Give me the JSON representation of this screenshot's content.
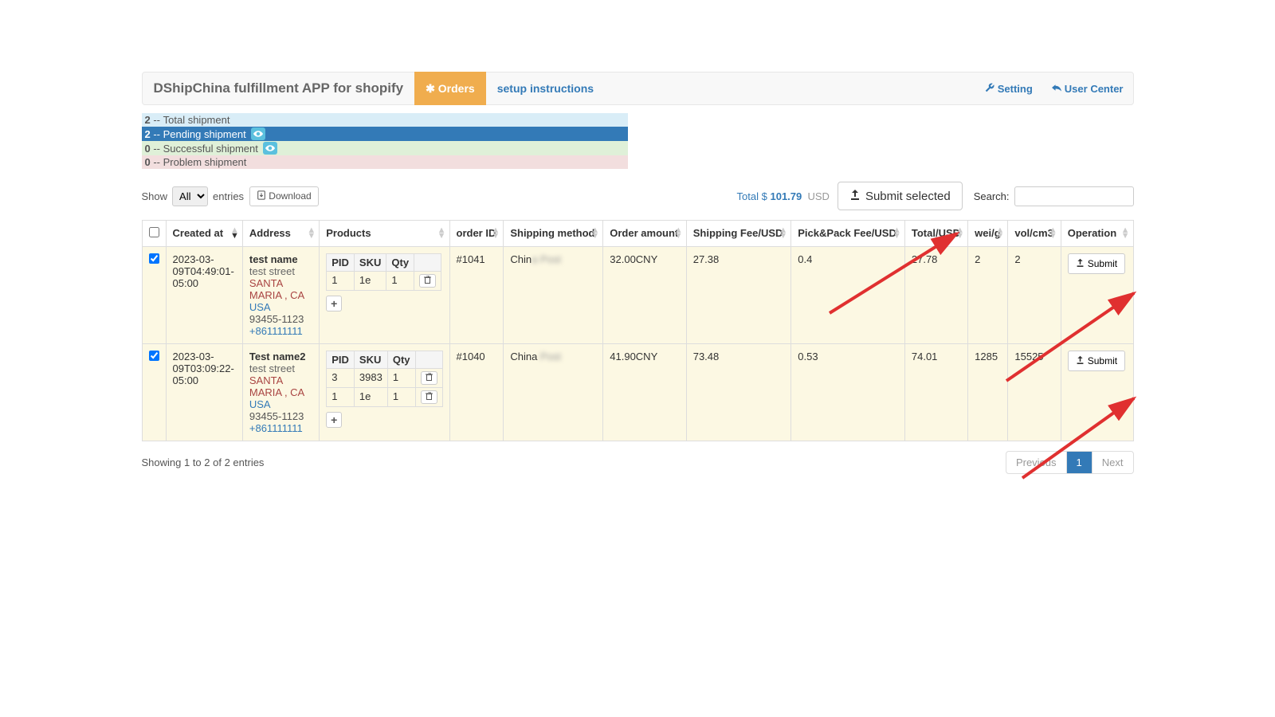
{
  "header": {
    "brand": "DShipChina fulfillment APP for shopify",
    "tab_orders": "Orders",
    "tab_setup": "setup instructions",
    "setting": "Setting",
    "user_center": "User Center"
  },
  "status": {
    "total": {
      "count": "2",
      "label": "Total shipment"
    },
    "pending": {
      "count": "2",
      "label": "Pending shipment"
    },
    "success": {
      "count": "0",
      "label": "Successful shipment"
    },
    "problem": {
      "count": "0",
      "label": "Problem shipment"
    }
  },
  "toolbar": {
    "show": "Show",
    "all": "All",
    "entries": "entries",
    "download": "Download",
    "total_prefix": "Total $",
    "total_amount": "101.79",
    "total_suffix": "USD",
    "submit_selected": "Submit selected",
    "search": "Search:"
  },
  "columns": {
    "created_at": "Created at",
    "address": "Address",
    "products": "Products",
    "order_id": "order ID",
    "shipping_method": "Shipping method",
    "order_amount": "Order amount",
    "shipping_fee": "Shipping Fee/USD",
    "pickpack_fee": "Pick&Pack Fee/USD",
    "total": "Total/USD",
    "wei": "wei/g",
    "vol": "vol/cm3",
    "operation": "Operation"
  },
  "ptable_headers": {
    "pid": "PID",
    "sku": "SKU",
    "qty": "Qty"
  },
  "rows": [
    {
      "checked": true,
      "created_at": "2023-03-09T04:49:01-05:00",
      "address": {
        "name": "test name",
        "street": "test street",
        "city": "SANTA MARIA , CA",
        "country": "USA",
        "zip": "93455-1123",
        "phone": "+861111111"
      },
      "products": [
        {
          "pid": "1",
          "sku": "1e",
          "qty": "1"
        }
      ],
      "order_id": "#1041",
      "shipping_method_visible": "Chin",
      "shipping_method_hidden": "a Post",
      "order_amount": "32.00CNY",
      "shipping_fee": "27.38",
      "pickpack_fee": "0.4",
      "total": "27.78",
      "wei": "2",
      "vol": "2",
      "submit": "Submit"
    },
    {
      "checked": true,
      "created_at": "2023-03-09T03:09:22-05:00",
      "address": {
        "name": "Test name2",
        "street": "test street",
        "city": "SANTA MARIA , CA",
        "country": "USA",
        "zip": "93455-1123",
        "phone": "+861111111"
      },
      "products": [
        {
          "pid": "3",
          "sku": "3983",
          "qty": "1"
        },
        {
          "pid": "1",
          "sku": "1e",
          "qty": "1"
        }
      ],
      "order_id": "#1040",
      "shipping_method_visible": "China",
      "shipping_method_hidden": " Post",
      "order_amount": "41.90CNY",
      "shipping_fee": "73.48",
      "pickpack_fee": "0.53",
      "total": "74.01",
      "wei": "1285",
      "vol": "15525",
      "submit": "Submit"
    }
  ],
  "footer": {
    "info": "Showing 1 to 2 of 2 entries",
    "previous": "Previous",
    "page1": "1",
    "next": "Next"
  }
}
